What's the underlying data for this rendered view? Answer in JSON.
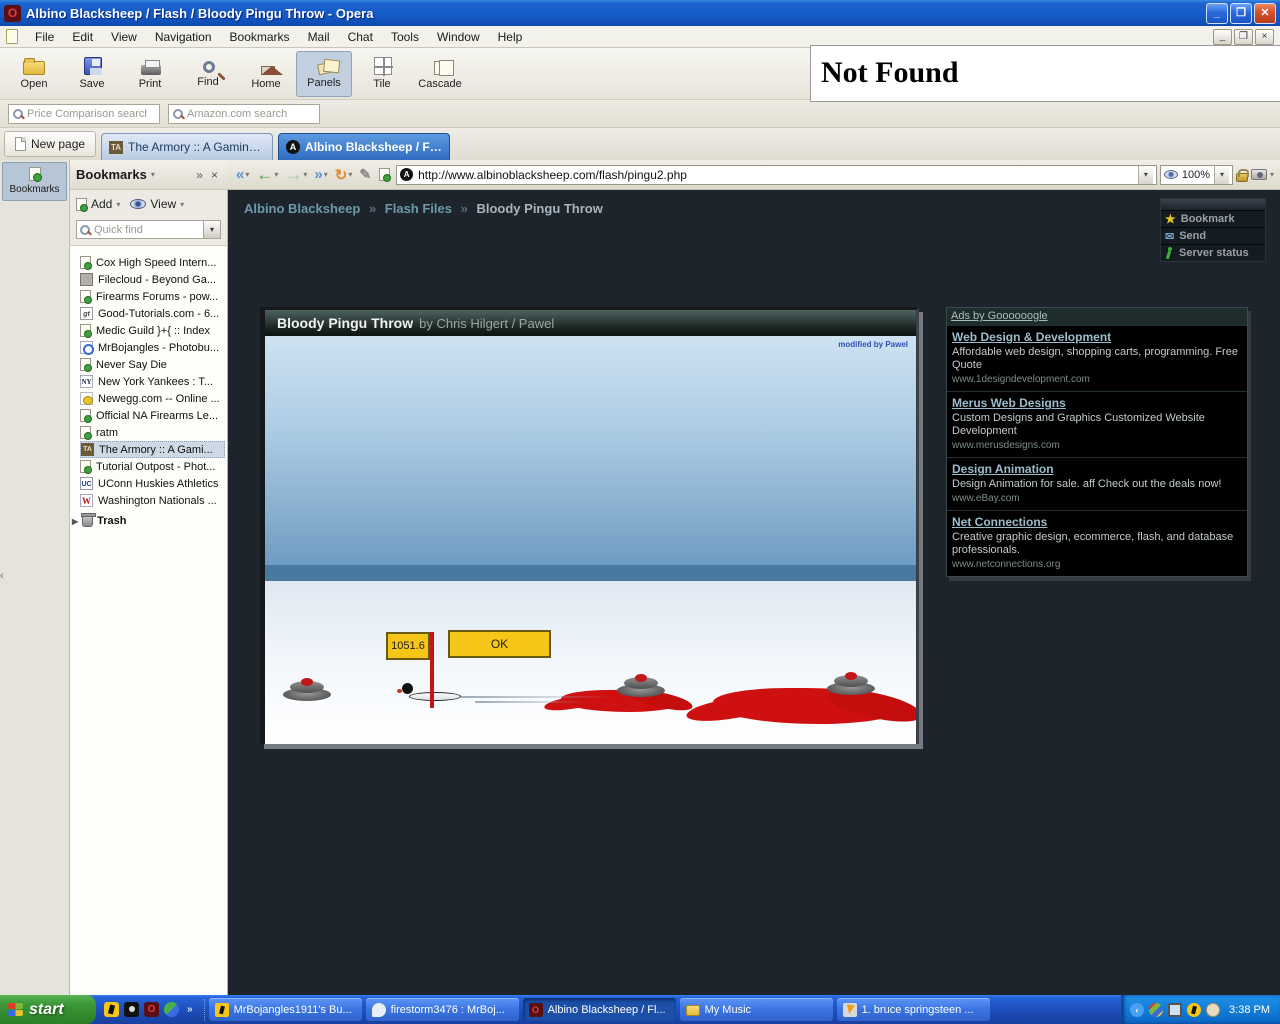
{
  "icons": {
    "minimize": "_",
    "restore": "❐",
    "close": "✕",
    "mdi_close": "×",
    "dropdown": "▾",
    "rewind": "«",
    "back": "←",
    "forward": "→",
    "fastforward": "»",
    "reload": "↻",
    "edit": "✎",
    "star": "★",
    "mail": "✉",
    "expander": "▶",
    "panel_expand": "»",
    "panel_close": "×",
    "collapse": "‹",
    "tray_collapse": "‹",
    "opera_letter": "O",
    "quicklaunch_more": "»"
  },
  "window": {
    "title": "Albino Blacksheep / Flash / Bloody Pingu Throw - Opera"
  },
  "menu": {
    "items": [
      "File",
      "Edit",
      "View",
      "Navigation",
      "Bookmarks",
      "Mail",
      "Chat",
      "Tools",
      "Window",
      "Help"
    ]
  },
  "toolbar": {
    "buttons": [
      {
        "label": "Open"
      },
      {
        "label": "Save"
      },
      {
        "label": "Print"
      },
      {
        "label": "Find"
      },
      {
        "label": "Home"
      },
      {
        "label": "Panels"
      },
      {
        "label": "Tile"
      },
      {
        "label": "Cascade"
      }
    ]
  },
  "search": {
    "fields": [
      {
        "placeholder": "Price Comparison search"
      },
      {
        "placeholder": "Amazon.com search"
      }
    ]
  },
  "tabs": {
    "new_page": "New page",
    "items": [
      {
        "label": "The Armory :: A Gaming C...",
        "favicon": "TA"
      },
      {
        "label": "Albino Blacksheep / Flash /...",
        "favicon": "A"
      }
    ]
  },
  "address": {
    "url": "http://www.albinoblacksheep.com/flash/pingu2.php",
    "favicon": "A",
    "zoom": "100%"
  },
  "panel": {
    "selector": "Bookmarks",
    "title": "Bookmarks",
    "add": "Add",
    "view": "View",
    "quickfind": "Quick find",
    "bookmarks": [
      {
        "label": "Cox High Speed Intern..."
      },
      {
        "label": "Filecloud - Beyond Ga..."
      },
      {
        "label": "Firearms Forums - pow..."
      },
      {
        "label": "Good-Tutorials.com - 6...",
        "icon_text": "gt"
      },
      {
        "label": "Medic Guild }+{ :: Index"
      },
      {
        "label": "MrBojangles - Photobu..."
      },
      {
        "label": "Never Say Die"
      },
      {
        "label": "New York Yankees : T...",
        "icon_text": "NY"
      },
      {
        "label": "Newegg.com -- Online ..."
      },
      {
        "label": "Official NA Firearms Le..."
      },
      {
        "label": "ratm"
      },
      {
        "label": "The Armory :: A Gami...",
        "icon_text": "TA"
      },
      {
        "label": "Tutorial Outpost - Phot..."
      },
      {
        "label": "UConn Huskies Athletics",
        "icon_text": "UC"
      },
      {
        "label": "Washington Nationals ...",
        "icon_text": "W"
      }
    ],
    "trash": "Trash"
  },
  "content": {
    "breadcrumb": {
      "part1": "Albino Blacksheep",
      "sep1": "»",
      "part2": "Flash Files",
      "sep2": "»",
      "part3": "Bloody Pingu Throw"
    },
    "quick_actions": {
      "bookmark": "Bookmark",
      "send": "Send",
      "server_status": "Server status"
    },
    "game": {
      "title": "Bloody Pingu Throw",
      "byline": "by Chris Hilgert / Pawel",
      "modified": "modified by Pawel",
      "score": "1051.6",
      "ok": "OK"
    },
    "ads": {
      "header": "Ads by Goooooogle",
      "items": [
        {
          "title": "Web Design & Development",
          "body": "Affordable web design, shopping carts, programming. Free Quote",
          "url": "www.1designdevelopment.com"
        },
        {
          "title": "Merus Web Designs",
          "body": "Custom Designs and Graphics Customized Website Development",
          "url": "www.merusdesigns.com"
        },
        {
          "title": "Design Animation",
          "body": "Design Animation for sale. aff Check out the deals now!",
          "url": "www.eBay.com"
        },
        {
          "title": "Net Connections",
          "body": "Creative graphic design, ecommerce, flash, and database professionals.",
          "url": "www.netconnections.org"
        }
      ]
    },
    "not_found": "Not Found"
  },
  "taskbar": {
    "start": "start",
    "tasks": [
      {
        "label": "MrBojangles1911's Bu..."
      },
      {
        "label": "firestorm3476 : MrBoj..."
      },
      {
        "label": "Albino Blacksheep / Fl..."
      },
      {
        "label": "My Music"
      },
      {
        "label": "1. bruce springsteen ..."
      }
    ],
    "clock": "3:38 PM"
  },
  "colors": {
    "accent_blue": "#2f6cc0",
    "content_bg": "#1d242b",
    "game_yellow": "#f5c518",
    "blood_red": "#cf1010",
    "taskbar_blue": "#1e50bc"
  }
}
